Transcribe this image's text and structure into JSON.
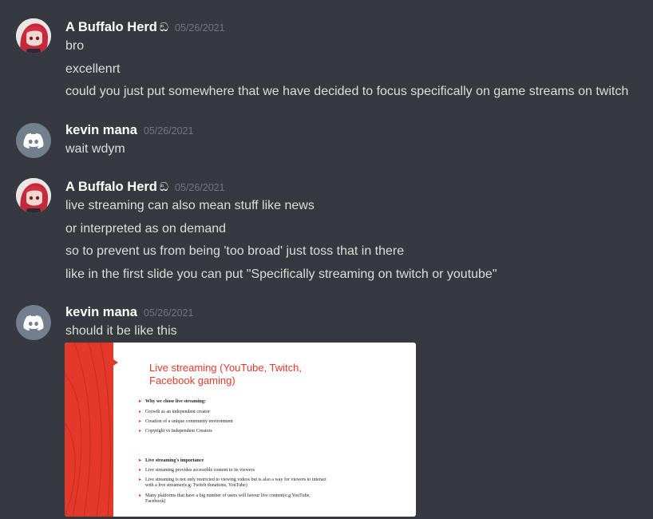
{
  "messages": [
    {
      "username": "A Buffalo Herd",
      "tag_glyph": "ඞ",
      "timestamp": "05/26/2021",
      "avatar": "anime-avatar",
      "lines": [
        "bro",
        "excellenrt",
        "could you just put somewhere that we have decided to focus specifically on game streams on twitch"
      ]
    },
    {
      "username": "kevin mana",
      "timestamp": "05/26/2021",
      "avatar": "discord-default-avatar",
      "lines": [
        "wait wdym"
      ]
    },
    {
      "username": "A Buffalo Herd",
      "tag_glyph": "ඞ",
      "timestamp": "05/26/2021",
      "avatar": "anime-avatar",
      "lines": [
        "live streaming can also mean stuff like news",
        "or interpreted as on demand",
        "so to prevent us from being 'too broad' just toss that in there",
        "like in the first slide you can put \"Specifically streaming on twitch or youtube\""
      ]
    },
    {
      "username": "kevin mana",
      "timestamp": "05/26/2021",
      "avatar": "discord-default-avatar",
      "lines": [
        "should it be like this"
      ]
    }
  ],
  "slide": {
    "title": "Live streaming (YouTube, Twitch, Facebook gaming)",
    "bullets_1": [
      "Why we chose live streaming:",
      "Growth as an independent creator",
      "Creation of a unique community environment",
      "Copyright vs independent Creators"
    ],
    "bullets_2": [
      "Live streaming's importance",
      "Live streaming provides accessible content to its viewers",
      "Live streaming is not only restricted to viewing videos but is also a way for viewers to interact with a live streamer(e.g: Twitch donations, YouTube)",
      "Many platforms that have a big number of users will favour live content(e.g YouTube, Facebook)"
    ],
    "accent_color": "#e2392a"
  },
  "colors": {
    "background": "#36393f",
    "username": "#ffffff",
    "text": "#dcddde",
    "timestamp": "#72767d"
  }
}
